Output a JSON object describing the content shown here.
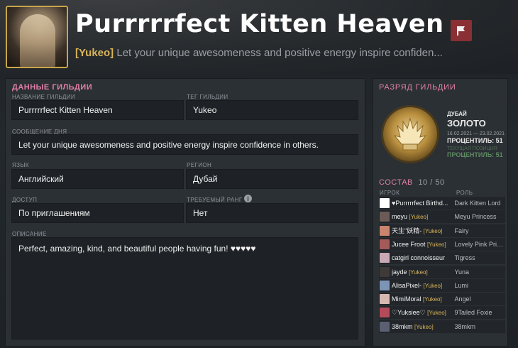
{
  "header": {
    "guild_name": "Purrrrrfect Kitten Heaven",
    "tag": "[Yukeo]",
    "motd_preview": "Let your unique awesomeness and positive energy inspire confiden..."
  },
  "details": {
    "section_title": "ДАННЫЕ ГИЛЬДИИ",
    "name_label": "НАЗВАНИЕ ГИЛЬДИИ",
    "name_value": "Purrrrrfect Kitten Heaven",
    "tag_label": "ТЕГ ГИЛЬДИИ",
    "tag_value": "Yukeo",
    "motd_label": "СООБЩЕНИЕ ДНЯ",
    "motd_value": "Let your unique awesomeness and positive energy inspire confidence in others.",
    "language_label": "ЯЗЫК",
    "language_value": "Английский",
    "region_label": "РЕГИОН",
    "region_value": "Дубай",
    "access_label": "ДОСТУП",
    "access_value": "По приглашениям",
    "required_rank_label": "ТРЕБУЕМЫЙ РАНГ",
    "required_rank_value": "Нет",
    "description_label": "ОПИСАНИЕ",
    "description_value": "Perfect, amazing, kind, and beautiful people having fun! ♥♥♥♥♥"
  },
  "rank": {
    "section_title": "РАЗРЯД ГИЛЬДИИ",
    "region": "ДУБАЙ",
    "tier": "ЗОЛОТО",
    "dates": "16.02.2021 — 23.02.2021",
    "percentile_label": "ПРОЦЕНТИЛЬ: 51",
    "current_position": "ТЕКУЩАЯ ПОЗИЦИЯ",
    "current_percentile": "ПРОЦЕНТИЛЬ: 51"
  },
  "roster": {
    "title": "СОСТАВ",
    "count": "10 / 50",
    "col_player": "ИГРОК",
    "col_role": "РОЛЬ",
    "members": [
      {
        "name": "♥Purrrrrfect Birthd...",
        "tag": "",
        "role": "Dark Kitten Lord",
        "color": "#ffffff"
      },
      {
        "name": "meyu",
        "tag": "[Yukeo]",
        "role": "Meyu Princess",
        "color": "#6b5a55"
      },
      {
        "name": "天生\"妖精-",
        "tag": "[Yukeo]",
        "role": "Fairy",
        "color": "#c9846e"
      },
      {
        "name": "Jucee Froot",
        "tag": "[Yukeo]",
        "role": "Lovely Pink Prin...",
        "color": "#a45a58"
      },
      {
        "name": "catgirl connoisseur",
        "tag": "",
        "role": "Tigress",
        "color": "#caa8b4"
      },
      {
        "name": "jayde",
        "tag": "[Yukeo]",
        "role": "Yuna",
        "color": "#3e3a38"
      },
      {
        "name": "AlisaPixel-",
        "tag": "[Yukeo]",
        "role": "Lumi",
        "color": "#7c95b6"
      },
      {
        "name": "MimiMoral",
        "tag": "[Yukeo]",
        "role": "Angel",
        "color": "#d6b8b0"
      },
      {
        "name": "♡Yuksiee♡",
        "tag": "[Yukeo]",
        "role": "9Tailed Foxie",
        "color": "#b54a5a"
      },
      {
        "name": "38mkm",
        "tag": "[Yukeo]",
        "role": "38mkm",
        "color": "#5a6072"
      }
    ]
  }
}
